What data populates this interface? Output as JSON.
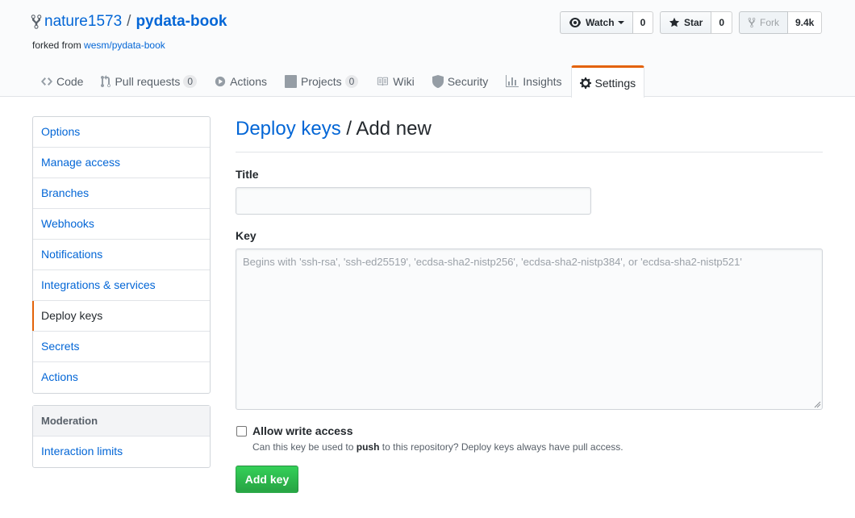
{
  "repo": {
    "owner": "nature1573",
    "separator": "/",
    "name": "pydata-book",
    "forked_from_prefix": "forked from",
    "forked_from_link": "wesm/pydata-book"
  },
  "actions": {
    "watch_label": "Watch",
    "watch_count": "0",
    "star_label": "Star",
    "star_count": "0",
    "fork_label": "Fork",
    "fork_count": "9.4k"
  },
  "nav": {
    "code": "Code",
    "pull_requests": "Pull requests",
    "pull_requests_count": "0",
    "actions": "Actions",
    "projects": "Projects",
    "projects_count": "0",
    "wiki": "Wiki",
    "security": "Security",
    "insights": "Insights",
    "settings": "Settings"
  },
  "sidebar": {
    "items": [
      "Options",
      "Manage access",
      "Branches",
      "Webhooks",
      "Notifications",
      "Integrations & services",
      "Deploy keys",
      "Secrets",
      "Actions"
    ],
    "moderation_heading": "Moderation",
    "moderation_items": [
      "Interaction limits"
    ]
  },
  "main": {
    "heading_link": "Deploy keys",
    "heading_sep": "/",
    "heading_rest": "Add new",
    "title_label": "Title",
    "title_value": "",
    "key_label": "Key",
    "key_placeholder": "Begins with 'ssh-rsa', 'ssh-ed25519', 'ecdsa-sha2-nistp256', 'ecdsa-sha2-nistp384', or 'ecdsa-sha2-nistp521'",
    "allow_write_label": "Allow write access",
    "note_before": "Can this key be used to",
    "note_bold": "push",
    "note_after": "to this repository? Deploy keys always have pull access.",
    "add_key_button": "Add key"
  },
  "colors": {
    "link": "#0366d6",
    "selected_accent": "#e36209",
    "primary_button": "#28a745"
  }
}
